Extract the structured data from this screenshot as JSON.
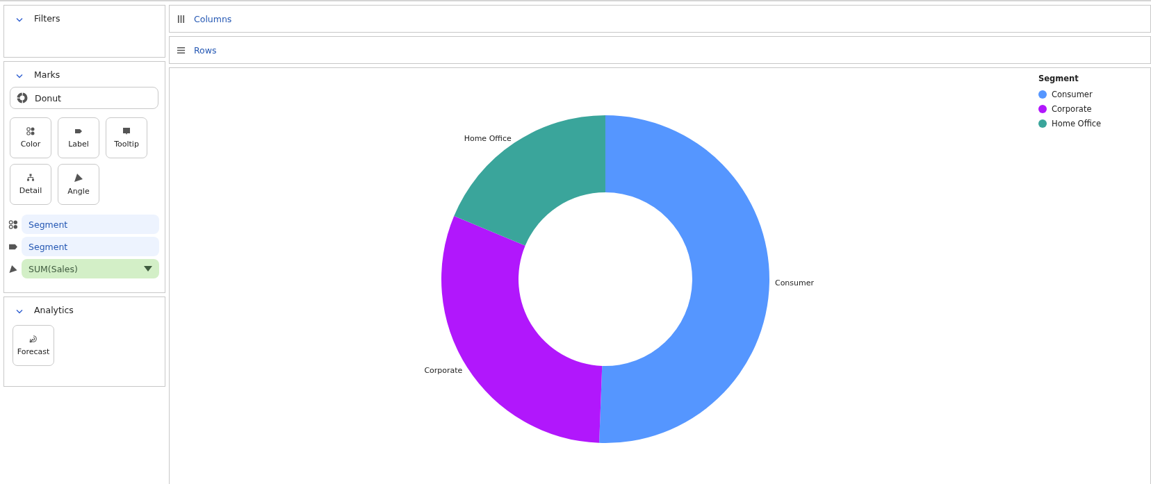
{
  "filters": {
    "title": "Filters",
    "expanded": true
  },
  "marks": {
    "title": "Marks",
    "expanded": true,
    "mark_type": "Donut",
    "cards": [
      {
        "kind": "color",
        "label": "Color"
      },
      {
        "kind": "label",
        "label": "Label"
      },
      {
        "kind": "tooltip",
        "label": "Tooltip"
      },
      {
        "kind": "detail",
        "label": "Detail"
      },
      {
        "kind": "angle",
        "label": "Angle"
      }
    ],
    "fields": [
      {
        "kind": "color",
        "label": "Segment",
        "color": "#edf3fe",
        "dropdown": false
      },
      {
        "kind": "label",
        "label": "Segment",
        "color": "#edf3fe",
        "dropdown": false
      },
      {
        "kind": "angle",
        "label": "SUM(Sales)",
        "color": "#d3efc7",
        "dropdown": true
      }
    ]
  },
  "analytics": {
    "title": "Analytics",
    "expanded": true,
    "items": [
      {
        "label": "Forecast"
      }
    ]
  },
  "columns_shelf": {
    "label": "Columns"
  },
  "rows_shelf": {
    "label": "Rows"
  },
  "view": {
    "chart_data": {
      "type": "donut",
      "categories": [
        "Consumer",
        "Corporate",
        "Home Office"
      ],
      "values": [
        50.6,
        30.7,
        18.7
      ]
    },
    "legend": {
      "title": "Segment",
      "items": [
        {
          "label": "Consumer",
          "color": "#5596ff"
        },
        {
          "label": "Corporate",
          "color": "#b117fc"
        },
        {
          "label": "Home Office",
          "color": "#3aa59b"
        }
      ]
    }
  }
}
